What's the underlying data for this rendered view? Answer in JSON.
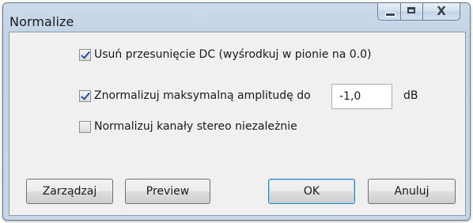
{
  "window": {
    "title": "Normalize",
    "close_glyph": "X"
  },
  "options": {
    "remove_dc": {
      "label": "Usuń przesunięcie DC (wyśrodkuj w pionie na 0.0)",
      "checked": true
    },
    "normalize_amplitude": {
      "label": "Znormalizuj maksymalną amplitudę do",
      "checked": true,
      "value": "-1,0",
      "unit": "dB"
    },
    "stereo_independent": {
      "label": "Normalizuj kanały stereo niezależnie",
      "checked": false
    }
  },
  "buttons": {
    "manage": "Zarządzaj",
    "preview": "Preview",
    "ok": "OK",
    "cancel": "Anuluj"
  },
  "icons": {
    "minimize": "minimize-icon",
    "maximize": "maximize-icon",
    "close": "close-icon"
  }
}
